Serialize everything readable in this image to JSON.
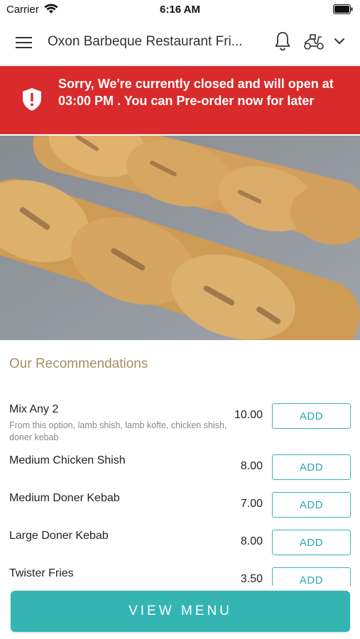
{
  "status_bar": {
    "carrier": "Carrier",
    "time": "6:16 AM"
  },
  "header": {
    "title": "Oxon Barbeque Restaurant Fri...",
    "icons": [
      "menu-icon",
      "bell-icon",
      "scooter-icon",
      "chevron-down-icon"
    ]
  },
  "banner": {
    "message": "Sorry, We're currently closed and will open at 03:00 PM . You can Pre-order now for later",
    "color": "#d92b2b",
    "icon": "shield-alert-icon"
  },
  "hero": {
    "icon": "food-image"
  },
  "recommendations": {
    "title": "Our Recommendations",
    "add_label": "ADD",
    "items": [
      {
        "name": "Mix Any 2",
        "description": "From this option, lamb shish, lamb kofte, chicken shish, doner kebab",
        "price": "10.00"
      },
      {
        "name": "Medium Chicken Shish",
        "description": "",
        "price": "8.00"
      },
      {
        "name": "Medium Doner Kebab",
        "description": "",
        "price": "7.00"
      },
      {
        "name": "Large Doner Kebab",
        "description": "",
        "price": "8.00"
      },
      {
        "name": "Twister Fries",
        "description": "",
        "price": "3.50"
      }
    ]
  },
  "footer": {
    "view_menu_label": "VIEW MENU",
    "accent": "#35b4b4"
  }
}
